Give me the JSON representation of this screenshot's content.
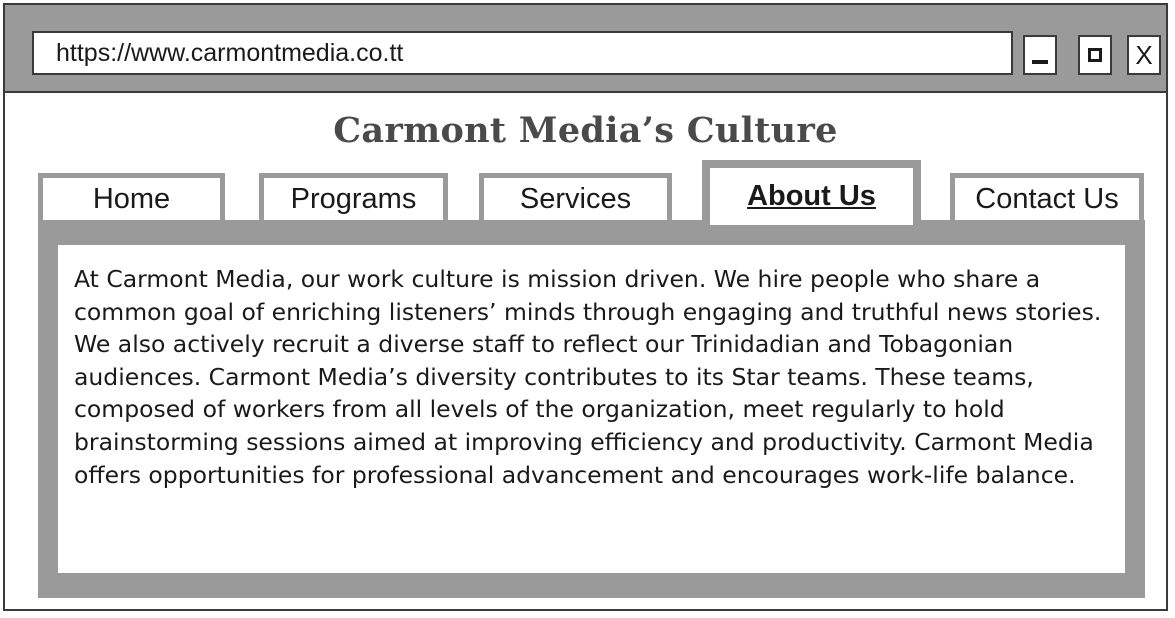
{
  "browser": {
    "url": "https://www.carmontmedia.co.tt",
    "controls": {
      "minimize_icon": "minimize-icon",
      "maximize_icon": "maximize-icon",
      "close_label": "X"
    }
  },
  "page": {
    "title": "Carmont Media’s Culture"
  },
  "nav": {
    "tabs": [
      {
        "label": "Home",
        "active": false
      },
      {
        "label": "Programs",
        "active": false
      },
      {
        "label": "Services",
        "active": false
      },
      {
        "label": "About Us",
        "active": true
      },
      {
        "label": "Contact Us",
        "active": false
      }
    ]
  },
  "content": {
    "paragraph": "At Carmont Media, our work culture is mission driven. We hire people who share a common goal of enriching listeners’ minds through engaging and truthful news stories. We also actively recruit a diverse staff to reflect our Trinidadian and Tobagonian audiences. Carmont Media’s diversity contributes to its Star teams. These teams, composed of workers from all levels of the organization, meet regularly to hold brainstorming sessions aimed at improving efficiency and productivity. Carmont Media offers opportunities for professional advancement and encourages work-life balance."
  },
  "colors": {
    "frame_gray": "#9a9a9a",
    "border_dark": "#3a3a3a",
    "title_text": "#4a4a4a"
  }
}
